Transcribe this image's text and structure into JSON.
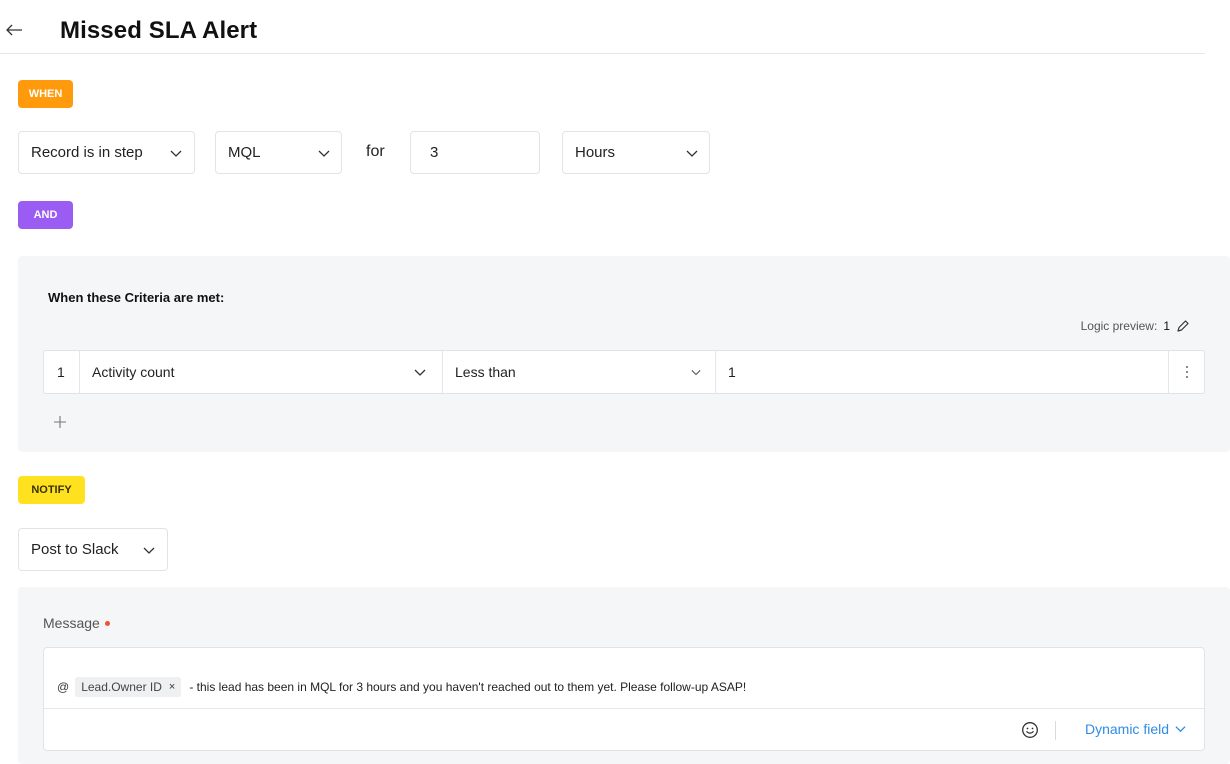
{
  "header": {
    "title": "Missed SLA Alert"
  },
  "when": {
    "badge": "WHEN",
    "step_select": "Record is in step",
    "stage_select": "MQL",
    "for_label": "for",
    "duration_value": "3",
    "unit_select": "Hours"
  },
  "and": {
    "badge": "AND"
  },
  "criteria": {
    "title": "When these Criteria are met:",
    "logic_preview_label": "Logic preview:",
    "logic_preview_value": "1",
    "rows": [
      {
        "index": "1",
        "field": "Activity count",
        "operator": "Less than",
        "value": "1"
      }
    ]
  },
  "notify": {
    "badge": "NOTIFY",
    "channel_select": "Post to Slack"
  },
  "message": {
    "label": "Message",
    "at": "@",
    "chip": "Lead.Owner ID",
    "chip_remove": "×",
    "text": "- this lead has been in MQL for 3 hours and you haven't reached out to them yet. Please follow-up ASAP!",
    "dynamic_field_label": "Dynamic field"
  },
  "colors": {
    "when_badge": "#ff9a0d",
    "and_badge": "#9a5cf2",
    "notify_badge": "#ffe11f",
    "link": "#2f8ce6",
    "required": "#f0542e"
  }
}
